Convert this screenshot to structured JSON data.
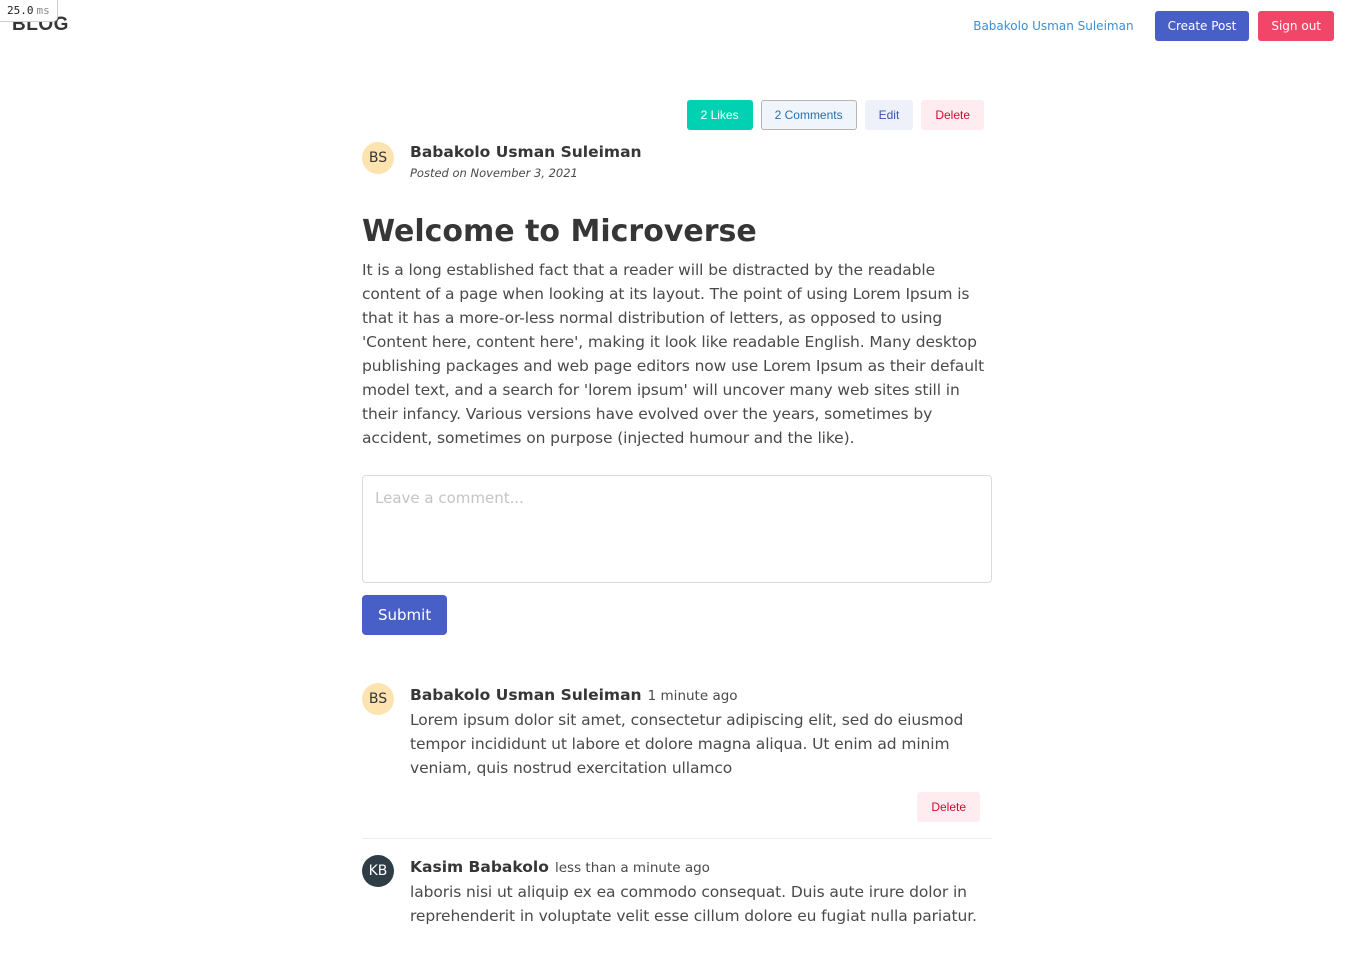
{
  "debug": {
    "timing_value": "25.0",
    "timing_unit": "ms"
  },
  "nav": {
    "brand": "BLOG",
    "user_link": "Babakolo Usman Suleiman",
    "create_post": "Create Post",
    "sign_out": "Sign out"
  },
  "post": {
    "actions": {
      "likes": "2 Likes",
      "comments": "2 Comments",
      "edit": "Edit",
      "delete": "Delete"
    },
    "author": {
      "initials": "BS",
      "name": "Babakolo Usman Suleiman",
      "posted_on": "Posted on November 3, 2021"
    },
    "title": "Welcome to Microverse",
    "body": "It is a long established fact that a reader will be distracted by the readable content of a page when looking at its layout. The point of using Lorem Ipsum is that it has a more-or-less normal distribution of letters, as opposed to using 'Content here, content here', making it look like readable English. Many desktop publishing packages and web page editors now use Lorem Ipsum as their default model text, and a search for 'lorem ipsum' will uncover many web sites still in their infancy. Various versions have evolved over the years, sometimes by accident, sometimes on purpose (injected humour and the like)."
  },
  "comment_form": {
    "placeholder": "Leave a comment...",
    "value": "",
    "submit": "Submit"
  },
  "comments": [
    {
      "initials": "BS",
      "author": "Babakolo Usman Suleiman",
      "time": "1 minute ago",
      "text": "Lorem ipsum dolor sit amet, consectetur adipiscing elit, sed do eiusmod tempor incididunt ut labore et dolore magna aliqua. Ut enim ad minim veniam, quis nostrud exercitation ullamco",
      "delete": "Delete"
    },
    {
      "initials": "KB",
      "author": "Kasim Babakolo",
      "time": "less than a minute ago",
      "text": "laboris nisi ut aliquip ex ea commodo consequat. Duis aute irure dolor in reprehenderit in voluptate velit esse cillum dolore eu fugiat nulla pariatur."
    }
  ],
  "colors": {
    "primary": "#485fc7",
    "danger": "#f14668",
    "success": "#00d1b2",
    "link": "#3e8ed0"
  }
}
